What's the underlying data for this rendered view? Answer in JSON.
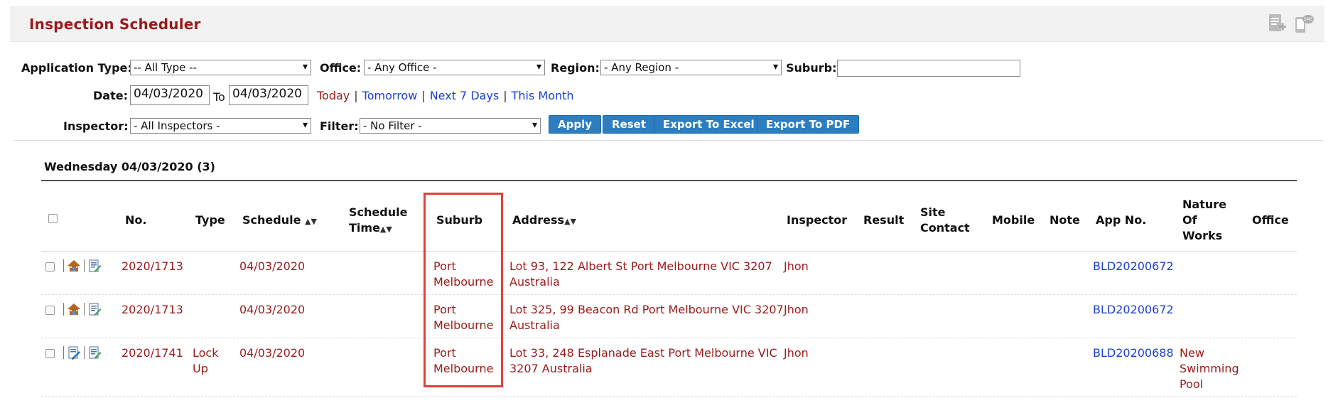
{
  "header": {
    "title": "Inspection Scheduler",
    "icons": [
      "add-document-icon",
      "sms-icon"
    ]
  },
  "filters": {
    "application_type": {
      "label": "Application Type:",
      "value": "-- All Type --"
    },
    "office": {
      "label": "Office:",
      "value": "- Any Office -"
    },
    "region": {
      "label": "Region:",
      "value": "- Any Region -"
    },
    "suburb": {
      "label": "Suburb:",
      "value": ""
    },
    "date": {
      "label": "Date:",
      "from": "04/03/2020",
      "to_label": "To",
      "to": "04/03/2020"
    },
    "quick_links": {
      "today": "Today",
      "tomorrow": "Tomorrow",
      "next7": "Next 7 Days",
      "month": "This Month",
      "separator": "|"
    },
    "inspector": {
      "label": "Inspector:",
      "value": "- All Inspectors -"
    },
    "filter": {
      "label": "Filter:",
      "value": "- No Filter -"
    }
  },
  "buttons": {
    "apply": "Apply",
    "reset": "Reset",
    "export_excel": "Export To Excel",
    "export_pdf": "Export To PDF"
  },
  "day": {
    "heading": "Wednesday 04/03/2020 (3)"
  },
  "table": {
    "columns": {
      "no": "No.",
      "type": "Type",
      "schedule": "Schedule",
      "schedule_time_1": "Schedule",
      "schedule_time_2": "Time",
      "suburb": "Suburb",
      "address": "Address",
      "inspector": "Inspector",
      "result": "Result",
      "site_contact_1": "Site",
      "site_contact_2": "Contact",
      "mobile": "Mobile",
      "note": "Note",
      "app_no": "App No.",
      "nature_1": "Nature",
      "nature_2": "Of",
      "nature_3": "Works",
      "office": "Office",
      "sort_glyph": "▲▼"
    },
    "rows": [
      {
        "no": "2020/1713",
        "type": "",
        "schedule": "04/03/2020",
        "suburb_1": "Port",
        "suburb_2": "Melbourne",
        "address_1": "Lot 93, 122 Albert St Port Melbourne VIC 3207",
        "address_2": "Australia",
        "inspector": "Jhon",
        "app_no": "BLD20200672",
        "nature_1": "",
        "nature_2": "",
        "nature_3": "",
        "icons": [
          "house-icon",
          "edit-document-icon"
        ]
      },
      {
        "no": "2020/1713",
        "type": "",
        "schedule": "04/03/2020",
        "suburb_1": "Port",
        "suburb_2": "Melbourne",
        "address_1": "Lot 325, 99 Beacon Rd Port Melbourne VIC 3207",
        "address_2": "Australia",
        "inspector": "Jhon",
        "app_no": "BLD20200672",
        "nature_1": "",
        "nature_2": "",
        "nature_3": "",
        "icons": [
          "house-icon",
          "edit-document-icon"
        ]
      },
      {
        "no": "2020/1741",
        "type_1": "Lock",
        "type_2": "Up",
        "schedule": "04/03/2020",
        "suburb_1": "Port",
        "suburb_2": "Melbourne",
        "address_1": "Lot 33, 248 Esplanade East Port Melbourne VIC",
        "address_2": "3207 Australia",
        "inspector": "Jhon",
        "app_no": "BLD20200688",
        "nature_1": "New",
        "nature_2": "Swimming",
        "nature_3": "Pool",
        "icons": [
          "pencil-document-icon",
          "edit-document-icon"
        ]
      }
    ]
  },
  "colors": {
    "title": "#9a1a1a",
    "link_red": "#9a1a1a",
    "link_blue": "#1d3fcf",
    "button": "#2d7ec1",
    "highlight": "#e0413b"
  }
}
